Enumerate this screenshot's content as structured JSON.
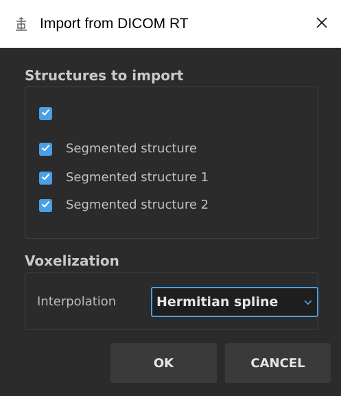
{
  "window": {
    "title": "Import from DICOM RT"
  },
  "structures": {
    "heading": "Structures to import",
    "items": [
      {
        "label": "",
        "checked": true
      },
      {
        "label": "Segmented structure",
        "checked": true
      },
      {
        "label": "Segmented structure 1",
        "checked": true
      },
      {
        "label": "Segmented structure 2",
        "checked": true
      }
    ]
  },
  "voxelization": {
    "heading": "Voxelization",
    "interpolation_label": "Interpolation",
    "interpolation_value": "Hermitian spline"
  },
  "buttons": {
    "ok": "OK",
    "cancel": "CANCEL"
  },
  "colors": {
    "accent": "#4aa0e6",
    "background": "#2b2b2b",
    "titlebar": "#ffffff"
  },
  "icons": {
    "title": "import-icon",
    "close": "close-icon",
    "dropdown": "chevron-down-icon",
    "check": "checkmark-icon"
  }
}
